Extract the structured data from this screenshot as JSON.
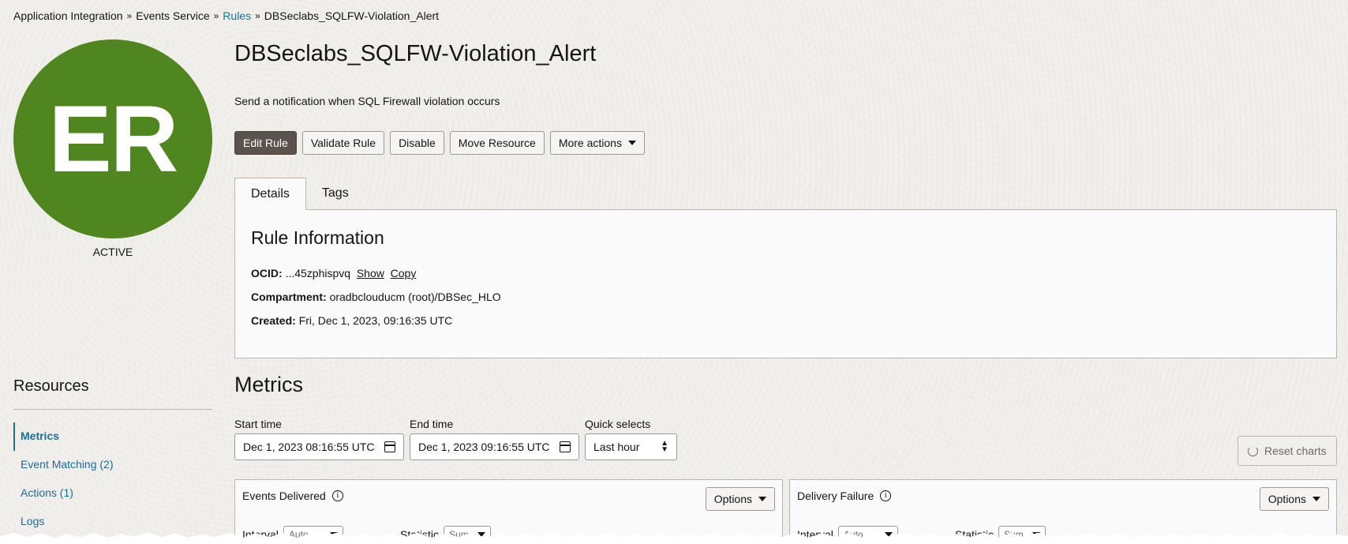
{
  "breadcrumb": {
    "items": [
      "Application Integration",
      "Events Service",
      "Rules",
      "DBSeclabs_SQLFW-Violation_Alert"
    ],
    "separator": "»"
  },
  "avatar": {
    "initials": "ER",
    "color": "#4f861f"
  },
  "status": "ACTIVE",
  "rule": {
    "title": "DBSeclabs_SQLFW-Violation_Alert",
    "description": "Send a notification when SQL Firewall violation occurs"
  },
  "actions": {
    "edit": "Edit Rule",
    "validate": "Validate Rule",
    "disable": "Disable",
    "move": "Move Resource",
    "more": "More actions"
  },
  "tabs": {
    "details": "Details",
    "tags": "Tags"
  },
  "rule_info": {
    "heading": "Rule Information",
    "ocid_label": "OCID:",
    "ocid_value": "...45zphispvq",
    "show": "Show",
    "copy": "Copy",
    "compartment_label": "Compartment:",
    "compartment_value": "oradbclouducm (root)/DBSec_HLO",
    "created_label": "Created:",
    "created_value": "Fri, Dec 1, 2023, 09:16:35 UTC"
  },
  "resources": {
    "title": "Resources",
    "items": [
      "Metrics",
      "Event Matching (2)",
      "Actions (1)",
      "Logs"
    ]
  },
  "metrics": {
    "title": "Metrics",
    "start_label": "Start time",
    "start_value": "Dec 1, 2023 08:16:55 UTC",
    "end_label": "End time",
    "end_value": "Dec 1, 2023 09:16:55 UTC",
    "quick_label": "Quick selects",
    "quick_value": "Last hour",
    "reset": "Reset charts"
  },
  "cards": [
    {
      "title": "Events Delivered",
      "options": "Options",
      "interval_label": "Interval",
      "interval_value": "Auto",
      "statistic_label": "Statistic",
      "statistic_value": "Sum"
    },
    {
      "title": "Delivery Failure",
      "options": "Options",
      "interval_label": "Interval",
      "interval_value": "Auto",
      "statistic_label": "Statistic",
      "statistic_value": "Sum"
    }
  ]
}
